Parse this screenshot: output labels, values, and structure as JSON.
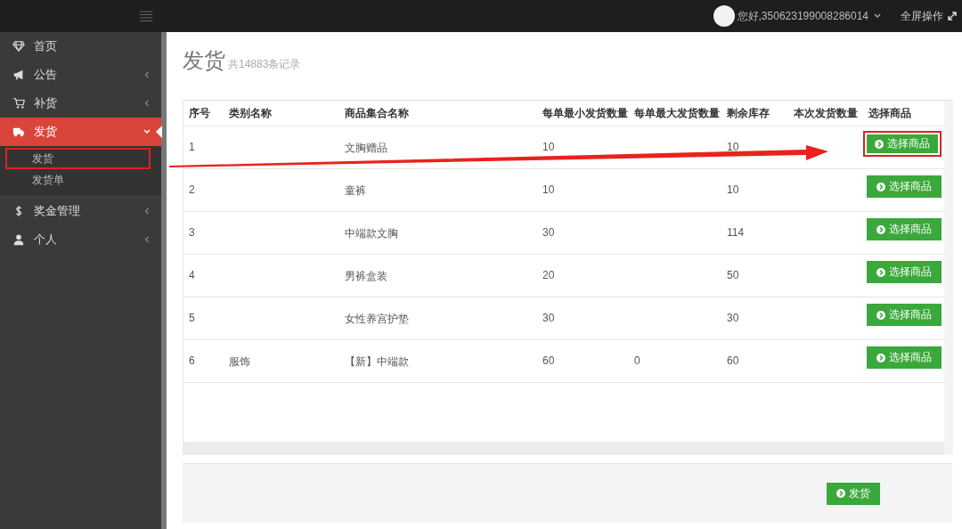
{
  "topbar": {
    "greeting": "您好,350623199008286014",
    "fullscreen": "全屏操作"
  },
  "sidebar": {
    "items": [
      {
        "label": "首页",
        "selected": false
      },
      {
        "label": "公告",
        "expanded": false,
        "selected": false
      },
      {
        "label": "补货",
        "expanded": false,
        "selected": false
      },
      {
        "label": "发货",
        "expanded": true,
        "selected": true,
        "children": [
          {
            "label": "发货",
            "highlighted": true
          },
          {
            "label": "发货单",
            "highlighted": false
          }
        ]
      },
      {
        "label": "奖金管理",
        "expanded": false,
        "selected": false
      },
      {
        "label": "个人",
        "expanded": false,
        "selected": false
      }
    ]
  },
  "page": {
    "title": "发货",
    "subtitle": "共14883条记录"
  },
  "table": {
    "columns": [
      "序号",
      "类别名称",
      "商品集合名称",
      "每单最小发货数量",
      "每单最大发货数量",
      "剩余库存",
      "本次发货数量",
      "选择商品"
    ],
    "rows": [
      {
        "cells": [
          "1",
          "",
          "文胸赠品",
          "10",
          "",
          "10",
          ""
        ],
        "button": "选择商品",
        "highlighted": true
      },
      {
        "cells": [
          "2",
          "",
          "童裤",
          "10",
          "",
          "10",
          ""
        ],
        "button": "选择商品",
        "highlighted": false
      },
      {
        "cells": [
          "3",
          "",
          "中端款文胸",
          "30",
          "",
          "114",
          ""
        ],
        "button": "选择商品",
        "highlighted": false
      },
      {
        "cells": [
          "4",
          "",
          "男裤盒装",
          "20",
          "",
          "50",
          ""
        ],
        "button": "选择商品",
        "highlighted": false
      },
      {
        "cells": [
          "5",
          "",
          "女性养宫护垫",
          "30",
          "",
          "30",
          ""
        ],
        "button": "选择商品",
        "highlighted": false
      },
      {
        "cells": [
          "6",
          "服饰",
          "【新】中端款",
          "60",
          "0",
          "60",
          ""
        ],
        "button": "选择商品",
        "highlighted": false
      }
    ]
  },
  "footer": {
    "button": "发货"
  }
}
